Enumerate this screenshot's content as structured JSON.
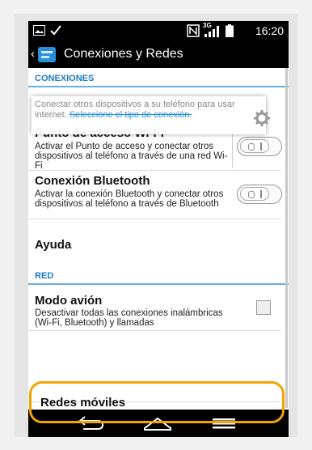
{
  "status_bar": {
    "time": "16:20",
    "network_badge": "3G",
    "icons": [
      "image-icon",
      "check-icon",
      "nfc-icon",
      "signal-icon",
      "battery-icon"
    ]
  },
  "action_bar": {
    "title": "Conexiones y Redes",
    "icon": "connections-app-icon"
  },
  "sections": [
    {
      "header": "CONEXIONES",
      "items": [
        {
          "title": "Punto de acceso Wi-Fi",
          "description": "Activar el Punto de acceso y conectar otros dispositivos al teléfono a través de una red Wi-Fi",
          "control": "toggle",
          "state": "off"
        },
        {
          "title": "Conexión Bluetooth",
          "description": "Activar la conexión Bluetooth y conectar otros dispositivos al teléfono a través de Bluetooth",
          "control": "toggle",
          "state": "off"
        },
        {
          "title": "Ayuda",
          "description": "",
          "control": "none"
        }
      ]
    },
    {
      "header": "RED",
      "items": [
        {
          "title": "Modo avión",
          "description": "Desactivar todas las conexiones inalámbricas (Wi-Fi, Bluetooth) y llamadas",
          "control": "checkbox",
          "state": "unchecked"
        },
        {
          "title": "Redes móviles",
          "description": "",
          "control": "none",
          "highlighted": true
        }
      ]
    }
  ],
  "tooltip": {
    "text_before": "Conectar otros dispositivos a su teléfono para usar internet. ",
    "text_highlight": "Seleccione el tipo de conexión."
  },
  "colors": {
    "accent": "#2a8fd6",
    "section_header": "#1a7bc7",
    "highlight_ring": "#f5a300"
  },
  "nav_bar": {
    "buttons": [
      "back-icon",
      "home-icon",
      "menu-icon"
    ]
  }
}
